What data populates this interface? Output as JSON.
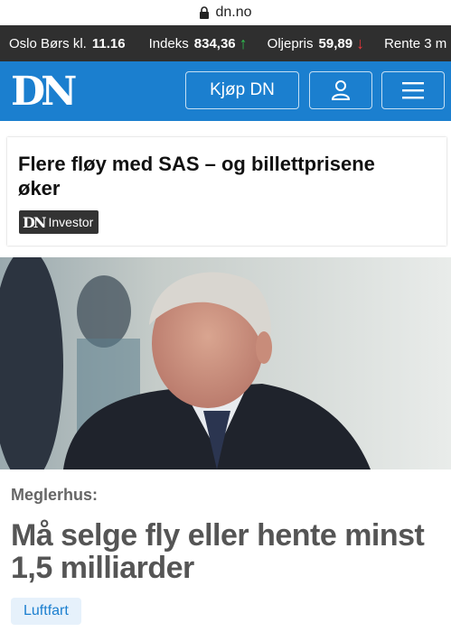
{
  "browser": {
    "url": "dn.no"
  },
  "ticker": [
    {
      "label": "Oslo Børs kl.",
      "value": "11.16",
      "direction": ""
    },
    {
      "label": "Indeks",
      "value": "834,36",
      "direction": "↑"
    },
    {
      "label": "Oljepris",
      "value": "59,89",
      "direction": "↓"
    },
    {
      "label": "Rente 3 m",
      "value": "",
      "direction": ""
    }
  ],
  "header": {
    "logo": "DN",
    "buy_label": "Kjøp DN",
    "user_icon": "user-icon",
    "menu_icon": "hamburger-menu-icon",
    "brand_color": "#1b7fcf"
  },
  "promo": {
    "headline": "Flere fløy med SAS – og billettprisene øker",
    "badge_logo": "DN",
    "badge_text": "Investor"
  },
  "article": {
    "kicker": "Meglerhus:",
    "headline": "Må selge fly eller hente minst 1,5 milliarder",
    "tag": "Luftfart"
  }
}
